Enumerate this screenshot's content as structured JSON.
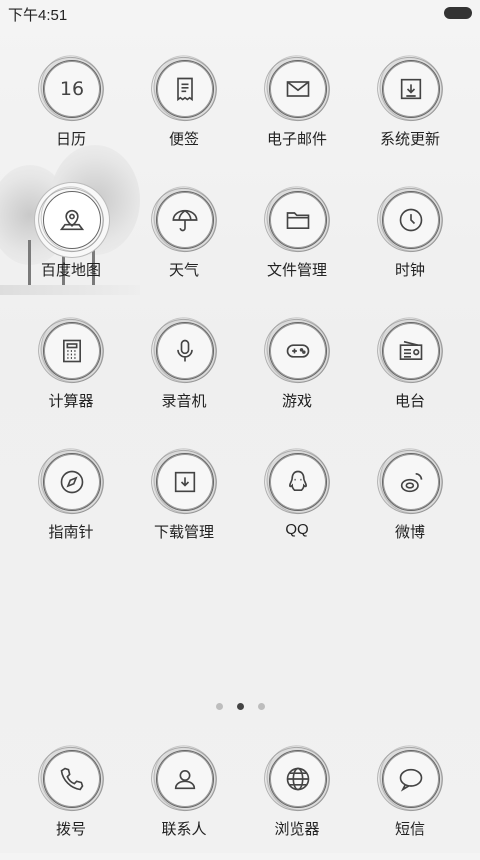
{
  "status": {
    "time": "下午4:51"
  },
  "pages": {
    "count": 3,
    "active": 1
  },
  "apps": [
    {
      "label": "日历",
      "icon": "calendar-icon",
      "text": "16"
    },
    {
      "label": "便签",
      "icon": "notes-icon"
    },
    {
      "label": "电子邮件",
      "icon": "mail-icon"
    },
    {
      "label": "系统更新",
      "icon": "system-update-icon"
    },
    {
      "label": "百度地图",
      "icon": "map-pin-icon"
    },
    {
      "label": "天气",
      "icon": "umbrella-icon"
    },
    {
      "label": "文件管理",
      "icon": "folder-icon"
    },
    {
      "label": "时钟",
      "icon": "clock-icon"
    },
    {
      "label": "计算器",
      "icon": "calculator-icon"
    },
    {
      "label": "录音机",
      "icon": "microphone-icon"
    },
    {
      "label": "游戏",
      "icon": "gamepad-icon"
    },
    {
      "label": "电台",
      "icon": "radio-icon"
    },
    {
      "label": "指南针",
      "icon": "compass-icon"
    },
    {
      "label": "下载管理",
      "icon": "download-icon"
    },
    {
      "label": "QQ",
      "icon": "qq-icon"
    },
    {
      "label": "微博",
      "icon": "weibo-icon"
    }
  ],
  "dock": [
    {
      "label": "拨号",
      "icon": "phone-icon"
    },
    {
      "label": "联系人",
      "icon": "contacts-icon"
    },
    {
      "label": "浏览器",
      "icon": "globe-icon"
    },
    {
      "label": "短信",
      "icon": "message-icon"
    }
  ]
}
